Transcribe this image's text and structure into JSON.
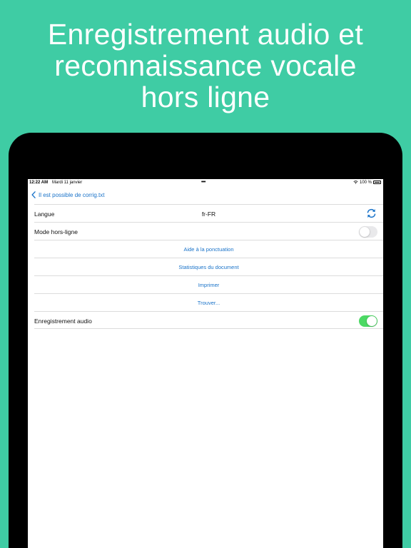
{
  "headline": {
    "line1": "Enregistrement audio et",
    "line2": "reconnaissance vocale",
    "line3": "hors ligne"
  },
  "colors": {
    "background": "#3fcca4",
    "accent": "#1a73c9",
    "toggle_on": "#4cd964",
    "toggle_off": "#e9e9eb"
  },
  "status_bar": {
    "time": "12:22 AM",
    "date": "Mardi 11 janvier",
    "multitasking_dots": "•••",
    "battery_percent": "100 %",
    "icons": [
      "wifi-icon",
      "battery-icon"
    ]
  },
  "nav": {
    "back_icon": "chevron-left-icon",
    "back_title": "Il est possible de corrig.txt"
  },
  "settings": {
    "language": {
      "label": "Langue",
      "value": "fr-FR",
      "icon": "sync-icon"
    },
    "offline_mode": {
      "label": "Mode hors-ligne",
      "enabled": false
    },
    "punctuation_help": {
      "label": "Aide à la ponctuation"
    },
    "document_stats": {
      "label": "Statistiques du document"
    },
    "print": {
      "label": "Imprimer"
    },
    "find": {
      "label": "Trouver..."
    },
    "audio_recording": {
      "label": "Enregistrement audio",
      "enabled": true
    }
  }
}
